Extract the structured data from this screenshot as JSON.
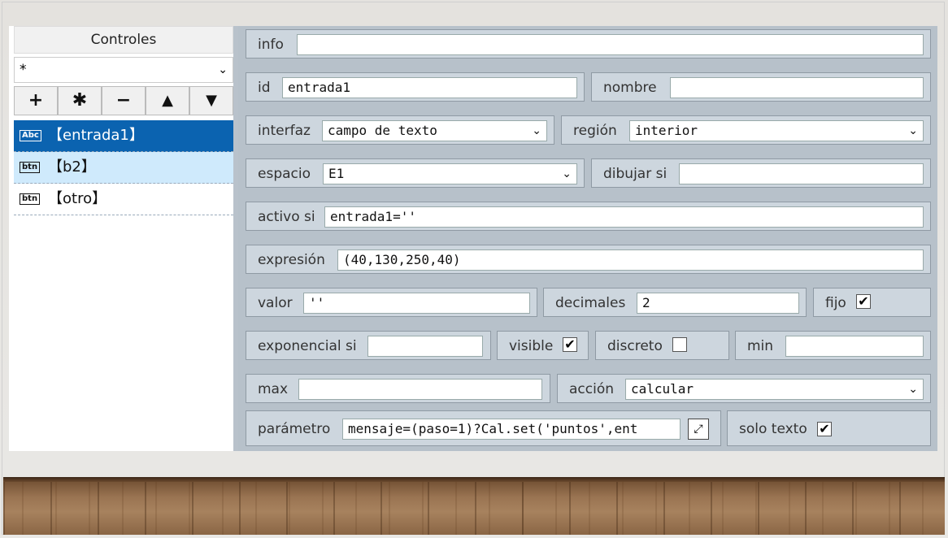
{
  "controls": {
    "title": "Controles",
    "filter": "*",
    "buttons": [
      "+",
      "✱",
      "−",
      "▲",
      "▼"
    ],
    "items": [
      {
        "icon": "Abc",
        "label": "【entrada1】",
        "state": "selected"
      },
      {
        "icon": "btn",
        "label": "【b2】",
        "state": "highlight"
      },
      {
        "icon": "btn",
        "label": "【otro】",
        "state": "normal"
      }
    ]
  },
  "props": {
    "info": {
      "label": "info",
      "value": ""
    },
    "id": {
      "label": "id",
      "value": "entrada1"
    },
    "nombre": {
      "label": "nombre",
      "value": ""
    },
    "interfaz": {
      "label": "interfaz",
      "value": "campo de texto"
    },
    "region": {
      "label": "región",
      "value": "interior"
    },
    "espacio": {
      "label": "espacio",
      "value": "E1"
    },
    "dibujar": {
      "label": "dibujar si",
      "value": ""
    },
    "activo": {
      "label": "activo si",
      "value": "entrada1=''"
    },
    "expresion": {
      "label": "expresión",
      "value": "(40,130,250,40)"
    },
    "valor": {
      "label": "valor",
      "value": "''"
    },
    "decimales": {
      "label": "decimales",
      "value": "2"
    },
    "fijo": {
      "label": "fijo",
      "checked": true
    },
    "exponencial": {
      "label": "exponencial si",
      "value": ""
    },
    "visible": {
      "label": "visible",
      "checked": true
    },
    "discreto": {
      "label": "discreto",
      "checked": false
    },
    "min": {
      "label": "min",
      "value": ""
    },
    "max": {
      "label": "max",
      "value": ""
    },
    "accion": {
      "label": "acción",
      "value": "calcular"
    },
    "parametro": {
      "label": "parámetro",
      "value": "mensaje=(paso=1)?Cal.set('puntos',ent"
    },
    "solotexto": {
      "label": "solo texto",
      "checked": true
    }
  }
}
